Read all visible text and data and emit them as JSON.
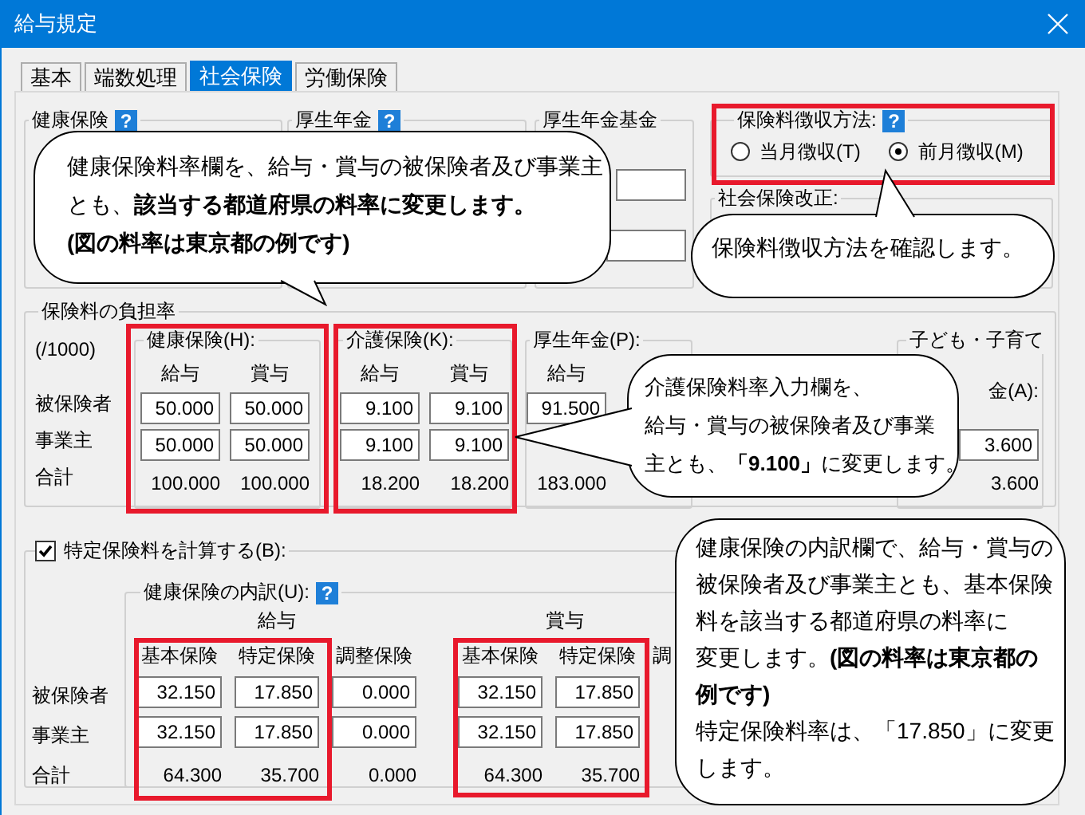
{
  "window": {
    "title": "給与規定"
  },
  "tabs": [
    {
      "label": "基本",
      "selected": false
    },
    {
      "label": "端数処理",
      "selected": false
    },
    {
      "label": "社会保険",
      "selected": true
    },
    {
      "label": "労働保険",
      "selected": false
    }
  ],
  "top_groups": [
    {
      "label": "健康保険",
      "help": "?"
    },
    {
      "label": "厚生年金",
      "help": "?"
    },
    {
      "label": "厚生年金基金"
    }
  ],
  "collection_method": {
    "label": "保険料徴収方法:",
    "help": "?",
    "options": [
      {
        "label": "当月徴収(T)",
        "selected": false
      },
      {
        "label": "前月徴収(M)",
        "selected": true
      }
    ]
  },
  "revision": {
    "label": "社会保険改正:"
  },
  "burden": {
    "label": "保険料の負担率",
    "unit": "(/1000)",
    "row_labels": [
      "被保険者",
      "事業主",
      "合計"
    ],
    "groups": [
      {
        "label": "健康保険(H):",
        "columns": [
          {
            "header": "給与",
            "insured": "50.000",
            "employer": "50.000",
            "total": "100.000"
          },
          {
            "header": "賞与",
            "insured": "50.000",
            "employer": "50.000",
            "total": "100.000"
          }
        ]
      },
      {
        "label": "介護保険(K):",
        "columns": [
          {
            "header": "給与",
            "insured": "9.100",
            "employer": "9.100",
            "total": "18.200"
          },
          {
            "header": "賞与",
            "insured": "9.100",
            "employer": "9.100",
            "total": "18.200"
          }
        ]
      },
      {
        "label": "厚生年金(P):",
        "columns": [
          {
            "header": "給与",
            "insured": "91.500",
            "total": "183.000"
          }
        ]
      },
      {
        "label": "子ども・子育て",
        "label_2": "金(A):",
        "columns": [
          {
            "employer": "3.600",
            "total": "3.600"
          }
        ]
      }
    ]
  },
  "specific": {
    "label": "特定保険料を計算する(B):",
    "checked": true,
    "row_labels": [
      "被保険者",
      "事業主",
      "合計"
    ],
    "breakdown": {
      "label": "健康保険の内訳(U):",
      "help": "?"
    },
    "sections": [
      {
        "label": "給与",
        "columns": [
          {
            "header": "基本保険",
            "insured": "32.150",
            "employer": "32.150",
            "total": "64.300"
          },
          {
            "header": "特定保険",
            "insured": "17.850",
            "employer": "17.850",
            "total": "35.700"
          },
          {
            "header": "調整保険",
            "insured": "0.000",
            "employer": "0.000",
            "total": "0.000"
          }
        ]
      },
      {
        "label": "賞与",
        "columns": [
          {
            "header": "基本保険",
            "insured": "32.150",
            "employer": "32.150",
            "total": "64.300"
          },
          {
            "header": "特定保険",
            "insured": "17.850",
            "employer": "17.850",
            "total": "35.700"
          },
          {
            "header": "調"
          }
        ]
      }
    ]
  },
  "callouts": [
    {
      "lines": [
        "健康保険料率欄を、給与・賞与の被保険者及び事業主",
        "とも、**該当する都道府県の料率に変更します。**",
        "**(図の料率は東京都の例です)**"
      ]
    },
    {
      "lines": [
        "保険料徴収方法を確認します。"
      ]
    },
    {
      "lines": [
        "介護保険料率入力欄を、",
        "給与・賞与の被保険者及び事業",
        "主とも、**「9.100」**に変更します。"
      ]
    },
    {
      "lines": [
        "健康保険の内訳欄で、給与・賞与の",
        "被保険者及び事業主とも、基本保険",
        "料を該当する都道府県の料率に",
        "変更します。**(図の料率は東京都の**",
        "**例です)**",
        "特定保険料率は、「17.850」に変更",
        "します。"
      ]
    }
  ]
}
